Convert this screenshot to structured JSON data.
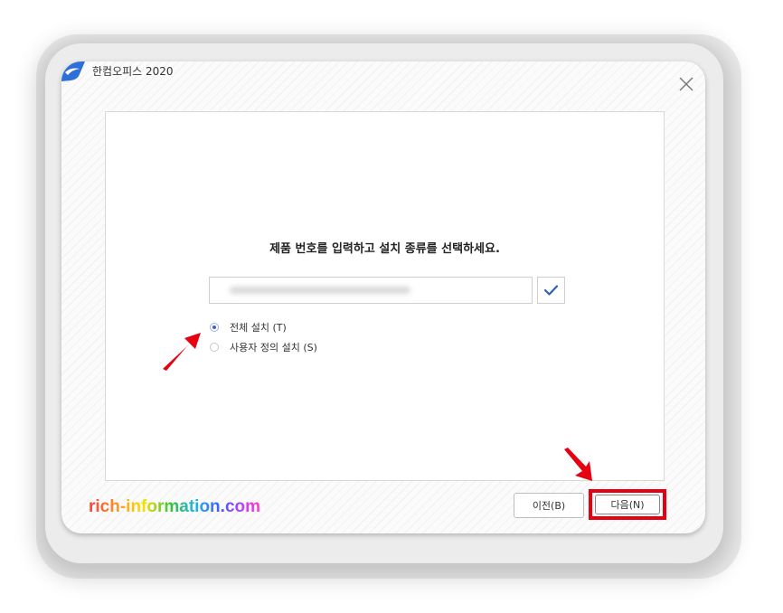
{
  "window": {
    "title": "한컴오피스 2020"
  },
  "main": {
    "heading": "제품 번호를 입력하고 설치 종류를 선택하세요.",
    "serial_value": "",
    "install_options": [
      {
        "label": "전체 설치 (T)",
        "selected": true
      },
      {
        "label": "사용자 정의 설치 (S)",
        "selected": false
      }
    ]
  },
  "footer": {
    "prev_label": "이전(B)",
    "next_label": "다음(N)"
  },
  "watermark": "rich-information.com",
  "colors": {
    "annotation_red": "#e60012",
    "radio_accent": "#3f5fcf",
    "check_icon": "#2f5fbf"
  },
  "icons": {
    "app_logo": "hancom-logo-icon",
    "close": "close-icon",
    "verify": "checkmark-icon",
    "annotation": "red-arrow-icon"
  }
}
